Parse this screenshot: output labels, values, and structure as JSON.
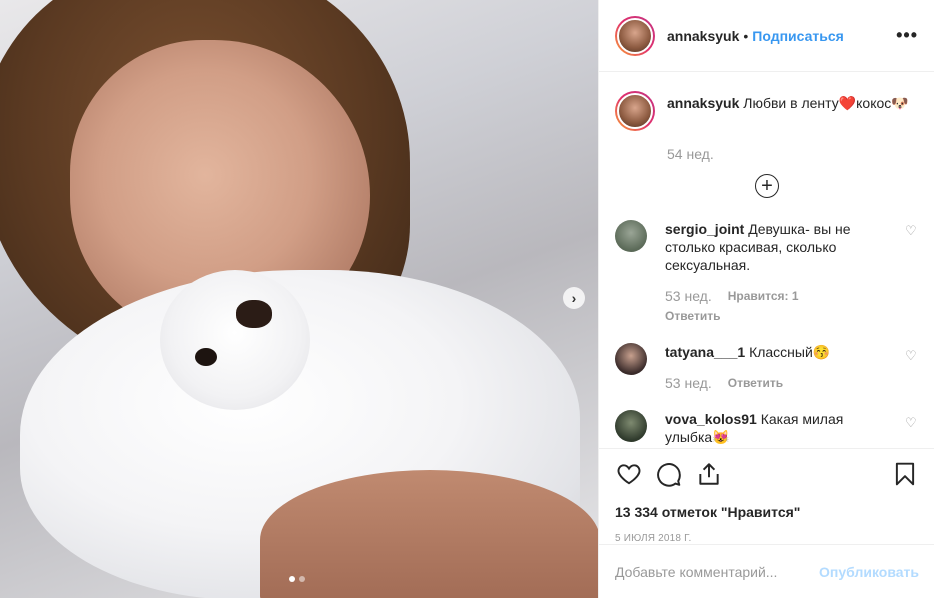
{
  "post": {
    "username": "annaksyuk",
    "follow_label": "Подписаться",
    "more_label": "•••",
    "caption_text": "Любви в ленту❤️кокос🐶",
    "caption_time": "54 нед.",
    "load_more_label": "+",
    "next_label": "›"
  },
  "comments": [
    {
      "username": "sergio_joint",
      "text": "Девушка- вы не столько красивая, сколько сексуальная.",
      "time": "53 нед.",
      "likes": "Нравится: 1",
      "reply": "Ответить",
      "avatar_color": "#5b6a58"
    },
    {
      "username": "tatyana___1",
      "text": "Классный😚",
      "time": "53 нед.",
      "reply": "Ответить",
      "avatar_color": "#3a2b2a"
    },
    {
      "username": "vova_kolos91",
      "text": "Какая милая улыбка😻",
      "avatar_color": "#2f3a2c"
    }
  ],
  "actions": {
    "likes_count": "13 334 отметок \"Нравится\"",
    "date": "5 ИЮЛЯ 2018 Г."
  },
  "comment_box": {
    "placeholder": "Добавьте комментарий...",
    "publish_label": "Опубликовать"
  },
  "colors": {
    "link": "#3897f0",
    "muted": "#999999",
    "publish_disabled": "#b3dbff"
  }
}
